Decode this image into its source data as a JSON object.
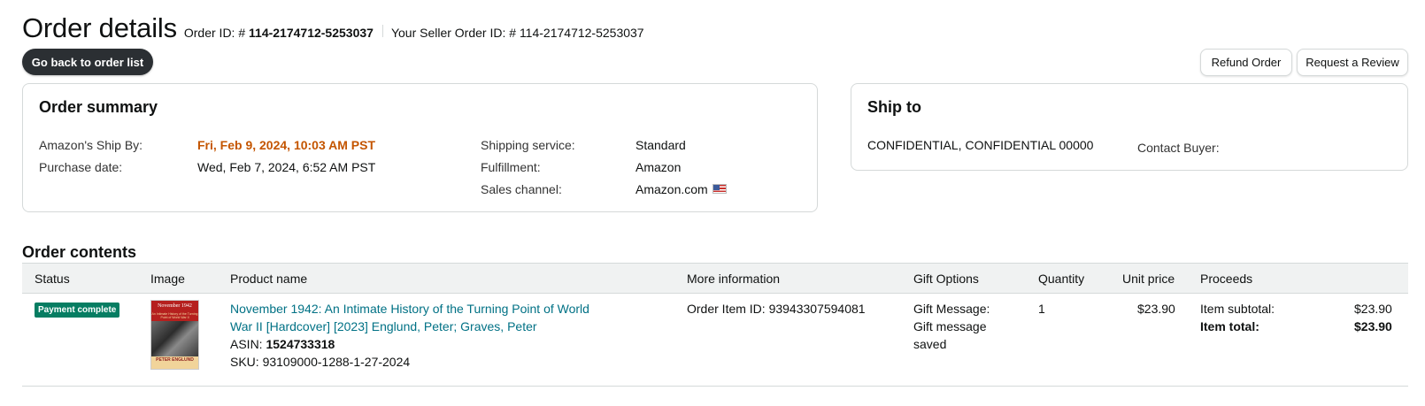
{
  "header": {
    "title": "Order details",
    "order_id_label": "Order ID: #",
    "order_id": "114-2174712-5253037",
    "seller_order_id_label": "Your Seller Order ID: #",
    "seller_order_id": "114-2174712-5253037"
  },
  "buttons": {
    "back": "Go back to order list",
    "refund": "Refund Order",
    "review": "Request a Review"
  },
  "summary": {
    "title": "Order summary",
    "ship_by_label": "Amazon's Ship By:",
    "ship_by_value": "Fri, Feb 9, 2024, 10:03 AM PST",
    "purchase_date_label": "Purchase date:",
    "purchase_date_value": "Wed, Feb 7, 2024, 6:52 AM PST",
    "shipping_service_label": "Shipping service:",
    "shipping_service_value": "Standard",
    "fulfillment_label": "Fulfillment:",
    "fulfillment_value": "Amazon",
    "sales_channel_label": "Sales channel:",
    "sales_channel_value": "Amazon.com",
    "sales_channel_icon": "us-flag-icon"
  },
  "ship_to": {
    "title": "Ship to",
    "address": "CONFIDENTIAL, CONFIDENTIAL 00000",
    "contact_label": "Contact Buyer:"
  },
  "contents": {
    "title": "Order contents",
    "columns": [
      "Status",
      "Image",
      "Product name",
      "More information",
      "Gift Options",
      "Quantity",
      "Unit price",
      "Proceeds"
    ],
    "items": [
      {
        "status": "Payment complete",
        "status_color": "#067d62",
        "image": {
          "title": "November 1942",
          "subtitle": "An Intimate History of the Turning Point of World War II",
          "author": "PETER ENGLUND"
        },
        "product_name_line1": "November 1942: An Intimate History of the Turning Point of World",
        "product_name_line2": "War II [Hardcover] [2023] Englund, Peter; Graves, Peter",
        "asin_label": "ASIN:",
        "asin": "1524733318",
        "sku_label": "SKU:",
        "sku": "93109000-1288-1-27-2024",
        "more_info": "Order Item ID: 93943307594081",
        "gift_line1": "Gift Message:",
        "gift_line2": "Gift message",
        "gift_line3": "saved",
        "quantity": "1",
        "unit_price": "$23.90",
        "subtotal_label": "Item subtotal:",
        "subtotal": "$23.90",
        "total_label": "Item total:",
        "total": "$23.90"
      }
    ]
  },
  "colors": {
    "accent_orange": "#c45500",
    "link": "#007185",
    "dark_button": "#2b2f33"
  }
}
